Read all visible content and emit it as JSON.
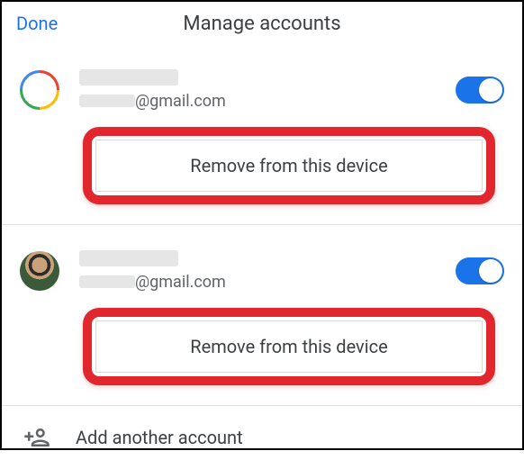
{
  "header": {
    "done_label": "Done",
    "title": "Manage accounts"
  },
  "accounts": [
    {
      "name_redacted": true,
      "email_user_redacted": true,
      "email_domain": "@gmail.com",
      "avatar_kind": "google-ring",
      "toggle_on": true,
      "remove_label": "Remove from this device",
      "highlight": true
    },
    {
      "name_redacted": true,
      "email_user_redacted": true,
      "email_domain": "@gmail.com",
      "avatar_kind": "photo",
      "toggle_on": true,
      "remove_label": "Remove from this device",
      "highlight": true
    }
  ],
  "add_another_label": "Add another account",
  "colors": {
    "accent": "#1a73e8",
    "highlight_ring": "#e2262d"
  }
}
